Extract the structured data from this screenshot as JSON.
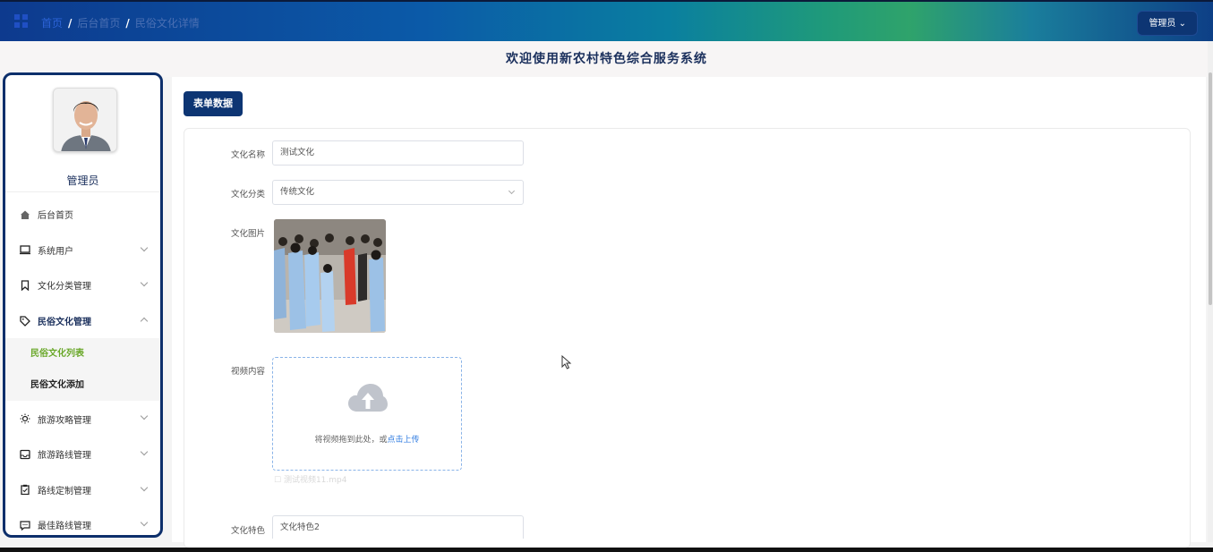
{
  "header": {
    "breadcrumb": [
      "首页",
      "后台首页",
      "民俗文化详情"
    ],
    "separator": "/",
    "admin_label": "管理员 ⌄"
  },
  "welcome": "欢迎使用新农村特色综合服务系统",
  "sidebar": {
    "username": "管理员",
    "items": [
      {
        "label": "后台首页",
        "icon": "home-icon"
      },
      {
        "label": "系统用户",
        "icon": "monitor-icon"
      },
      {
        "label": "文化分类管理",
        "icon": "bookmark-icon"
      },
      {
        "label": "民俗文化管理",
        "icon": "tag-icon"
      },
      {
        "label": "旅游攻略管理",
        "icon": "sun-icon"
      },
      {
        "label": "旅游路线管理",
        "icon": "inbox-icon"
      },
      {
        "label": "路线定制管理",
        "icon": "clipboard-icon"
      },
      {
        "label": "最佳路线管理",
        "icon": "message-icon"
      }
    ],
    "submenu": [
      "民俗文化列表",
      "民俗文化添加"
    ]
  },
  "form": {
    "tab": "表单数据",
    "name_label": "文化名称",
    "name_value": "测试文化",
    "category_label": "文化分类",
    "category_value": "传统文化",
    "image_label": "文化图片",
    "video_label": "视频内容",
    "upload_text": "将视频拖到此处，或",
    "upload_link": "点击上传",
    "uploaded_file": "测试视频11.mp4",
    "feature_label": "文化特色",
    "feature_value": "文化特色2"
  },
  "colors": {
    "navy": "#0d3573",
    "active_green": "#6aa82a",
    "link_blue": "#2c7ae0"
  }
}
